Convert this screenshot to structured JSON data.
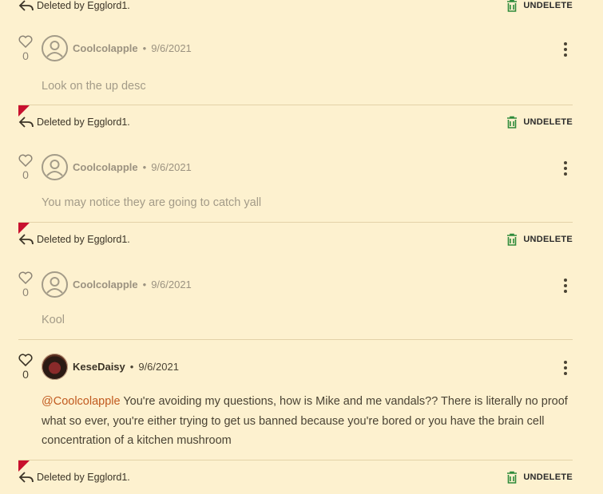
{
  "deleted_label": "Deleted by Egglord1.",
  "undelete_label": "UNDELETE",
  "comments": [
    {
      "likes": "0",
      "user": "Coolcolapple",
      "date": "9/6/2021",
      "text": "Look on the up desc"
    },
    {
      "likes": "0",
      "user": "Coolcolapple",
      "date": "9/6/2021",
      "text": "You may notice they are going to catch yall"
    },
    {
      "likes": "0",
      "user": "Coolcolapple",
      "date": "9/6/2021",
      "text": "Kool"
    },
    {
      "likes": "0",
      "user": "KeseDaisy",
      "date": "9/6/2021",
      "mention": "@Coolcolapple",
      "text": " You're avoiding my questions, how is Mike and me vandals?? There is literally no proof what so ever, you're either trying to get us banned because you're bored or you have the brain cell concentration of a kitchen mushroom"
    }
  ],
  "colors": {
    "accent_red": "#c8102e",
    "undelete_green": "#2e8b3a",
    "mention": "#c15a1f",
    "background": "#fdf1cf"
  },
  "icons": [
    "reply-arrow-icon",
    "trash-restore-icon",
    "heart-icon",
    "user-avatar-icon",
    "kebab-menu-icon"
  ]
}
